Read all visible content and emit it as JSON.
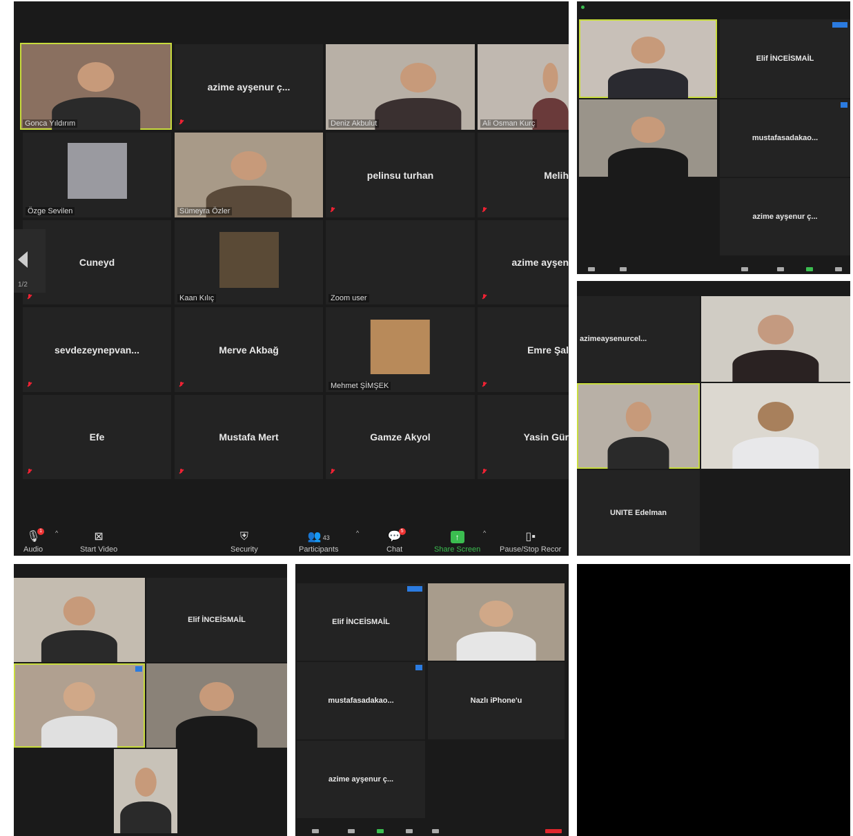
{
  "main": {
    "tiles": [
      {
        "name": "Gonca Yıldırım"
      },
      {
        "name": "azime ayşenur ç..."
      },
      {
        "name": "Deniz Akbulut"
      },
      {
        "name": "Ali Osman Kurç"
      },
      {
        "name": "Özge Sevilen"
      },
      {
        "name": "Sümeyra Özler"
      },
      {
        "name": "pelinsu turhan"
      },
      {
        "name": "Melih"
      },
      {
        "name": "Cuneyd"
      },
      {
        "name": "Kaan Kılıç"
      },
      {
        "name": "Zoom user"
      },
      {
        "name": "azime ayşen"
      },
      {
        "name": "sevdezeynepvan..."
      },
      {
        "name": "Merve Akbağ"
      },
      {
        "name": "Mehmet ŞİMŞEK"
      },
      {
        "name": "Emre Şal"
      },
      {
        "name": "Efe"
      },
      {
        "name": "Mustafa Mert"
      },
      {
        "name": "Gamze Akyol"
      },
      {
        "name": "Yasin Gür"
      }
    ],
    "page_indicator": "1/2",
    "toolbar": {
      "audio": "Audio",
      "audio_badge": "1",
      "start_video": "Start Video",
      "security": "Security",
      "participants": "Participants",
      "participants_count": "43",
      "chat": "Chat",
      "chat_badge": "5",
      "share_screen": "Share Screen",
      "record": "Pause/Stop Recor"
    }
  },
  "top_right": {
    "tiles": [
      {
        "name": "Elif İNCEİSMAİL"
      },
      {
        "name": "mustafasadakao..."
      },
      {
        "name": "azime ayşenur ç..."
      }
    ]
  },
  "mid_right": {
    "tiles": [
      {
        "name": "azimeaysenurcel..."
      },
      {
        "name": "UNITE Edelman"
      }
    ]
  },
  "bottom_left": {
    "tiles": [
      {
        "name": "Elif İNCEİSMAİL"
      }
    ]
  },
  "bottom_mid": {
    "tiles": [
      {
        "name": "Elif İNCEİSMAİL"
      },
      {
        "name": "mustafasadakao..."
      },
      {
        "name": "Nazlı iPhone'u"
      },
      {
        "name": "azime ayşenur ç..."
      }
    ]
  },
  "colors": {
    "highlight": "#c8dc3c",
    "share_green": "#3bbd50",
    "mute_red": "#e22233",
    "tile_bg": "#232323"
  }
}
